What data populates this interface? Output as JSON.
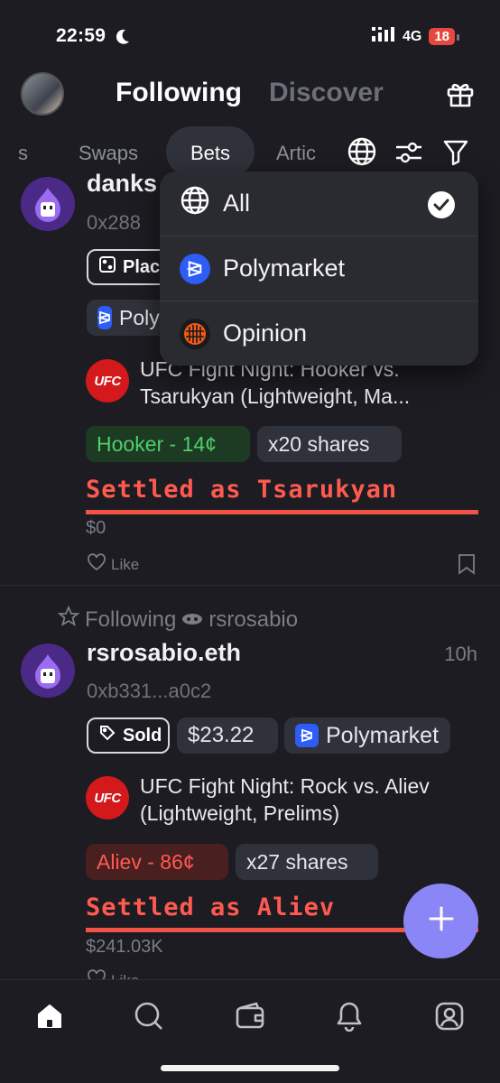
{
  "status": {
    "time": "22:59",
    "network": "4G",
    "battery": "18"
  },
  "header": {
    "tab_following": "Following",
    "tab_discover": "Discover"
  },
  "filters": {
    "partial_left": "s",
    "swaps": "Swaps",
    "bets": "Bets",
    "partial_right": "Artic"
  },
  "dropdown": {
    "items": [
      {
        "label": "All",
        "selected": true
      },
      {
        "label": "Polymarket"
      },
      {
        "label": "Opinion"
      }
    ]
  },
  "post1": {
    "name_partial": "danks",
    "address_partial": "0x288",
    "action_partial": "Plac",
    "platform_partial": "Poly",
    "market_title": "UFC Fight Night: Hooker vs. Tsarukyan (Lightweight, Ma...",
    "market_logo": "UFC",
    "outcome": "Hooker - 14¢",
    "shares": "x20 shares",
    "settled": "Settled as Tsarukyan",
    "amount": "$0",
    "like_label": "Like"
  },
  "post2": {
    "context_label": "Following",
    "context_user": "rsrosabio",
    "name": "rsrosabio.eth",
    "time": "10h",
    "address": "0xb331...a0c2",
    "action": "Sold",
    "value": "$23.22",
    "platform": "Polymarket",
    "market_title": "UFC Fight Night: Rock vs. Aliev (Lightweight, Prelims)",
    "market_logo": "UFC",
    "outcome": "Aliev - 86¢",
    "shares": "x27 shares",
    "settled": "Settled as Aliev",
    "amount": "$241.03K",
    "like_label": "Like"
  },
  "colors": {
    "accent_fab": "#8a86f5",
    "settled_red": "#f25347",
    "polymarket_blue": "#2d5cf6",
    "ufc_red": "#d4191c"
  }
}
